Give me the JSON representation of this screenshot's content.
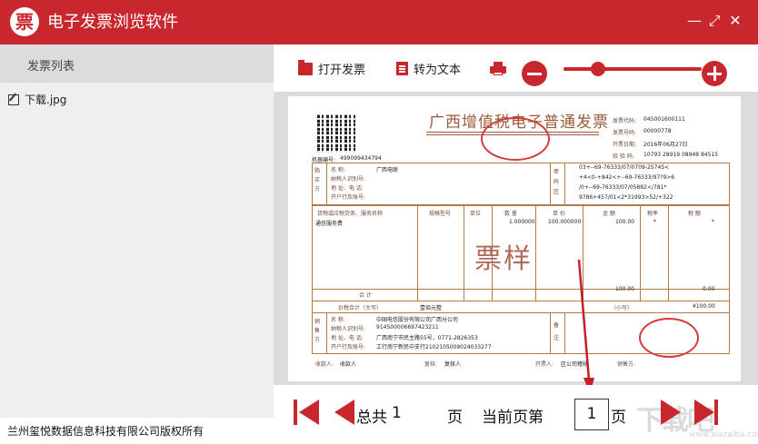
{
  "app": {
    "title": "电子发票浏览软件",
    "logo_glyph": "票",
    "accent_color": "#c9272e"
  },
  "window_controls": [
    {
      "name": "minimize",
      "glyph": "—"
    },
    {
      "name": "maximize",
      "glyph": "⤢"
    },
    {
      "name": "close",
      "glyph": "✕"
    }
  ],
  "sidebar": {
    "header": "发票列表",
    "files": [
      {
        "label": "下载.jpg",
        "icon": "edit-icon"
      }
    ],
    "footer": "兰州玺悦数据信息科技有限公司版权所有"
  },
  "toolbar": {
    "open_label": "打开发票",
    "convert_label": "转为文本",
    "print_icon": "printer-icon",
    "zoom_level": 0.25
  },
  "invoice": {
    "title": "广西增值税电子普通发票",
    "machine_no_label": "机器编号:",
    "machine_no": "499099434794",
    "code_label": "发票代码:",
    "code": "045001600111",
    "number_label": "发票号码:",
    "number": "00000778",
    "date_label": "开票日期:",
    "date": "2016年06月27日",
    "check_label": "校 验 码:",
    "check": "10793 28919 08948 84515",
    "buyer_side": "购买方",
    "buyer_name_label": "名      称:",
    "buyer_name": "广西电联",
    "buyer_tax_label": "纳税人识别号:",
    "buyer_addr_label": "地 址、电 话:",
    "buyer_bank_label": "开户行及账号:",
    "cipher_side": "密码区",
    "cipher_lines": [
      "03+--69-76333/07/0709-25745<",
      "+4<0-+842<+--69-76333/97?9>6",
      "/0+--69-76333/07/05882</781*",
      "9786+457/01<2*31993>52/+322"
    ],
    "col_goods": "货物或应税劳务、服务名称",
    "col_spec": "规格型号",
    "col_unit": "单位",
    "col_qty": "数  量",
    "col_price": "单 价",
    "col_amount": "金  额",
    "col_rate": "税率",
    "col_tax": "税  额",
    "item_name": "通信服务费",
    "item_qty": "1.000000",
    "item_price": "100.000000",
    "item_amount": "100.00",
    "item_rate": "*",
    "item_tax": "*",
    "subtotal_label": "合   计",
    "subtotal_amount": "100.00",
    "subtotal_tax": "0.00",
    "total_label": "价税合计（大写）",
    "total_words": "壹佰元整",
    "total_small_label": "（小写）",
    "total_small": "¥100.00",
    "seller_side": "销售方",
    "seller_name": "中国电信股份有限公司广西分公司",
    "seller_tax": "914500006697423211",
    "seller_addr": "广西南宁市民主路55号，0771-2826353",
    "seller_bank": "工行南宁新民中支行2102105009024033277",
    "remark_side": "备注",
    "payee_label": "收款人:",
    "payee": "收款人",
    "reviewer_label": "复核:",
    "reviewer": "复核人",
    "drawer_label": "开票人:",
    "drawer": "区公司稽核",
    "seller_role_label": "销售方:",
    "watermark": "票样"
  },
  "pager": {
    "total_prefix": "总共",
    "total_pages": "1",
    "page_unit": "页",
    "current_prefix": "当前页第",
    "current_page": "1",
    "current_suffix": "页"
  },
  "site_watermark": "下载吧",
  "site_watermark_url": "www.xiazaiba.com"
}
